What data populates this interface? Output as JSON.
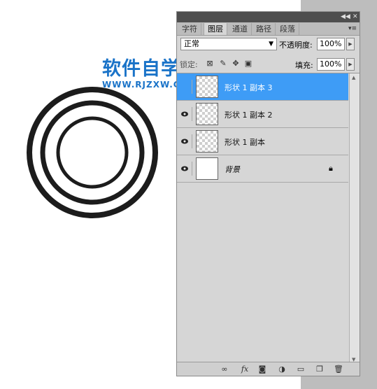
{
  "watermark": {
    "title": "软件自学网",
    "url": "WWW.RJZXW.COM"
  },
  "panel": {
    "tabs": [
      {
        "label": "字符",
        "active": false
      },
      {
        "label": "图层",
        "active": true
      },
      {
        "label": "通道",
        "active": false
      },
      {
        "label": "路径",
        "active": false
      },
      {
        "label": "段落",
        "active": false
      }
    ],
    "blend_mode": "正常",
    "opacity_label": "不透明度:",
    "opacity_value": "100%",
    "lock_label": "锁定:",
    "fill_label": "填充:",
    "fill_value": "100%",
    "layers": [
      {
        "name": "形状 1 副本 3",
        "selected": true,
        "visible": true
      },
      {
        "name": "形状 1 副本 2",
        "selected": false,
        "visible": true
      },
      {
        "name": "形状 1 副本",
        "selected": false,
        "visible": true
      },
      {
        "name": "背景",
        "selected": false,
        "visible": true,
        "locked": true
      }
    ],
    "bottom_icons": [
      "link-icon",
      "fx-icon",
      "mask-icon",
      "adjustment-icon",
      "group-icon",
      "new-layer-icon",
      "trash-icon"
    ],
    "accent_color": "#3e9cf6"
  }
}
